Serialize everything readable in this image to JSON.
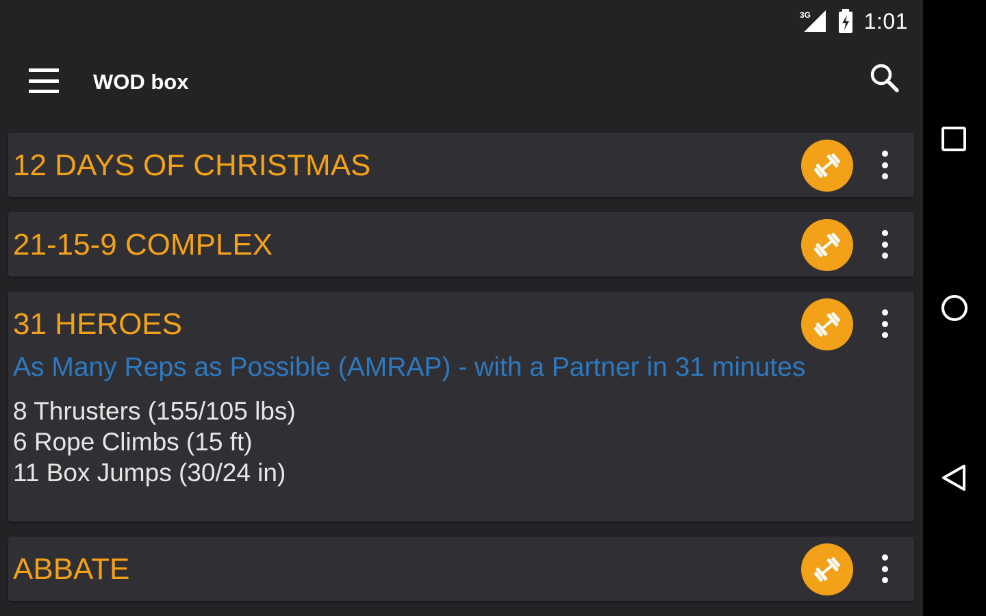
{
  "status_bar": {
    "network": "3G",
    "clock": "1:01",
    "icons": [
      "signal-icon",
      "battery-icon"
    ]
  },
  "app_bar": {
    "title": "WOD box",
    "icons": [
      "menu-icon",
      "search-icon"
    ]
  },
  "colors": {
    "accent": "#f3a118",
    "link": "#2e79c0",
    "card_bg": "#303034",
    "background": "#232326"
  },
  "wods": [
    {
      "title": "12 DAYS OF CHRISTMAS"
    },
    {
      "title": "21-15-9 COMPLEX"
    },
    {
      "title": "31 HEROES",
      "type": "As Many Reps as Possible (AMRAP) - with a Partner in 31 minutes",
      "movements": [
        "8 Thrusters (155/105 lbs)",
        "6 Rope Climbs (15 ft)",
        "11 Box Jumps (30/24 in)"
      ]
    },
    {
      "title": "ABBATE"
    }
  ],
  "card_icons": [
    "dumbbell-icon",
    "more-vert-icon"
  ],
  "nav_bar": {
    "icons": [
      "recents-icon",
      "home-icon",
      "back-icon"
    ]
  }
}
